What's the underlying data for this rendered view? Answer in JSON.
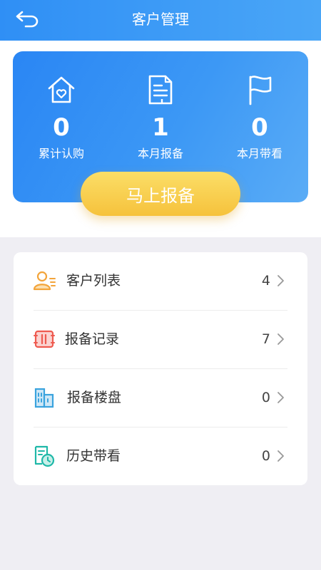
{
  "header": {
    "title": "客户管理",
    "back_icon": "back-arrow-icon"
  },
  "stats": [
    {
      "icon": "home-heart-icon",
      "value": "0",
      "label": "累计认购"
    },
    {
      "icon": "document-icon",
      "value": "1",
      "label": "本月报备"
    },
    {
      "icon": "flag-icon",
      "value": "0",
      "label": "本月带看"
    }
  ],
  "report_button": {
    "label": "马上报备"
  },
  "menu": [
    {
      "icon": "customer-list-icon",
      "label": "客户列表",
      "count": "4"
    },
    {
      "icon": "report-record-icon",
      "label": "报备记录",
      "count": "7"
    },
    {
      "icon": "building-icon",
      "label": "报备楼盘",
      "count": "0"
    },
    {
      "icon": "history-view-icon",
      "label": "历史带看",
      "count": "0"
    }
  ],
  "colors": {
    "header": "#3796f6",
    "card": "#3a95f5",
    "button": "#f8cd4c",
    "background": "#efeef3"
  }
}
